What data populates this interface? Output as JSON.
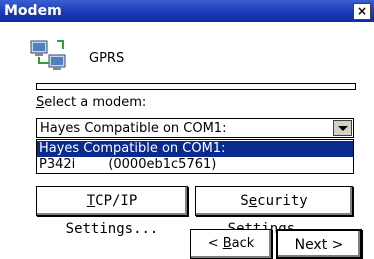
{
  "window": {
    "title": "Modem",
    "close_glyph": "×"
  },
  "connection": {
    "icon": "network-connection-icon",
    "name": "GPRS"
  },
  "progress": {
    "value": 0
  },
  "select_modem": {
    "label_accel": "S",
    "label_rest": "elect a modem:",
    "current_value": "Hayes Compatible on COM1:",
    "options": [
      {
        "text": "Hayes Compatible on COM1:",
        "selected": true
      },
      {
        "text": "P342i        (0000eb1c5761)",
        "selected": false
      }
    ]
  },
  "buttons": {
    "tcp_accel": "T",
    "tcp_rest": "CP/IP Settings...",
    "sec_pre": "S",
    "sec_accel": "e",
    "sec_rest": "curity Settings...",
    "back_pre": "< ",
    "back_accel": "B",
    "back_rest": "ack",
    "next_label": "Next >"
  },
  "colors": {
    "titlebar": "#1838b4",
    "selection": "#0a2a8e"
  }
}
